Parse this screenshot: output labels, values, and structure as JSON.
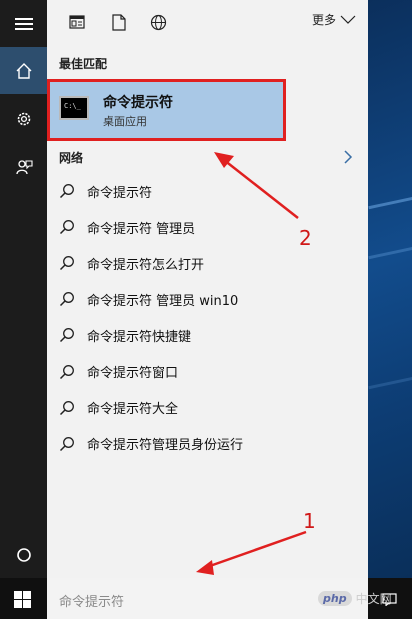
{
  "top_bar": {
    "more_label": "更多"
  },
  "sections": {
    "best_match": "最佳匹配",
    "network": "网络"
  },
  "best_match": {
    "title": "命令提示符",
    "subtitle": "桌面应用",
    "icon_text": "C:\\_"
  },
  "results": [
    "命令提示符",
    "命令提示符 管理员",
    "命令提示符怎么打开",
    "命令提示符 管理员 win10",
    "命令提示符快捷键",
    "命令提示符窗口",
    "命令提示符大全",
    "命令提示符管理员身份运行"
  ],
  "search": {
    "placeholder": "命令提示符"
  },
  "annotations": {
    "step1": "1",
    "step2": "2"
  },
  "watermark": {
    "logo": "php",
    "text": "中文网"
  },
  "colors": {
    "highlight_bg": "#a9c8e6",
    "annotation": "#e02020",
    "rail_active": "#2d4e6e"
  },
  "icons": [
    "hamburger-icon",
    "home-icon",
    "gear-icon",
    "feedback-icon",
    "document-icon",
    "file-icon",
    "globe-icon",
    "chevron-down-icon",
    "chevron-right-icon",
    "search-icon",
    "power-icon",
    "windows-icon",
    "notification-icon"
  ]
}
